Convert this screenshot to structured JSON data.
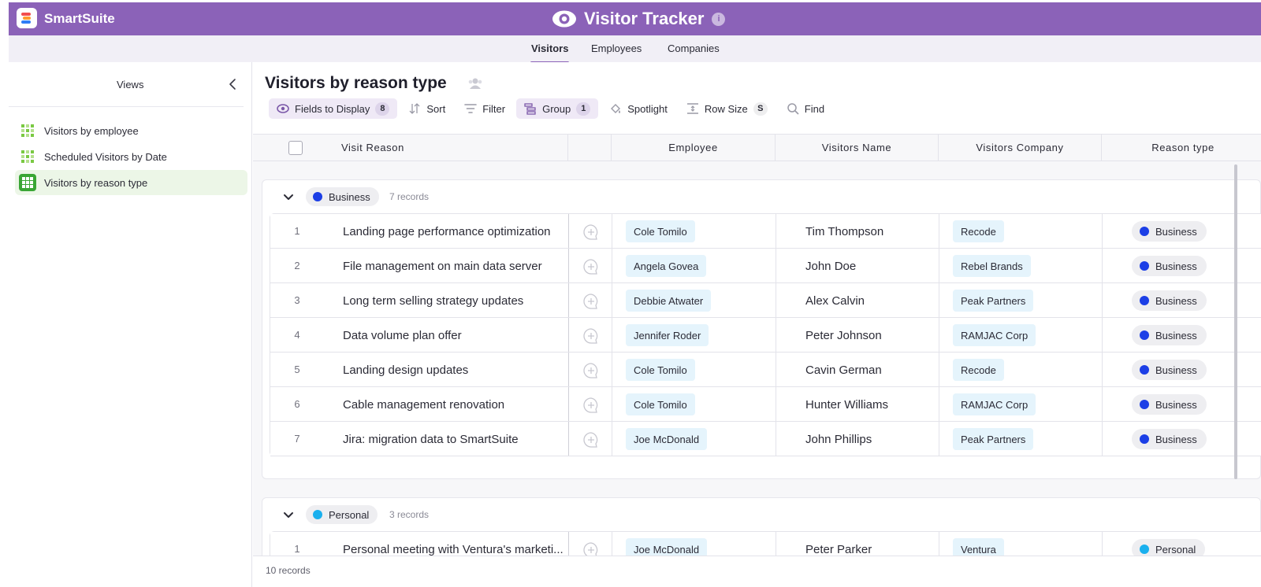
{
  "brand": {
    "name": "SmartSuite"
  },
  "app": {
    "title": "Visitor Tracker",
    "info_icon": "info-icon",
    "accent": "#8b62b8"
  },
  "tabs": [
    {
      "label": "Visitors",
      "active": true
    },
    {
      "label": "Employees",
      "active": false
    },
    {
      "label": "Companies",
      "active": false
    }
  ],
  "sidebar": {
    "title": "Views",
    "items": [
      {
        "label": "Visitors by employee",
        "icon": "grid-view-icon",
        "active": false
      },
      {
        "label": "Scheduled Visitors by Date",
        "icon": "grid-view-icon",
        "active": false
      },
      {
        "label": "Visitors by reason type",
        "icon": "grid-view-icon",
        "active": true
      }
    ]
  },
  "view": {
    "title": "Visitors by reason type",
    "toolbar": {
      "fields": {
        "label": "Fields to Display",
        "count": "8"
      },
      "sort": {
        "label": "Sort"
      },
      "filter": {
        "label": "Filter"
      },
      "group": {
        "label": "Group",
        "count": "1"
      },
      "spotlight": {
        "label": "Spotlight"
      },
      "rowsize": {
        "label": "Row Size",
        "value": "S"
      },
      "find": {
        "label": "Find"
      }
    },
    "columns": {
      "visit_reason": "Visit Reason",
      "employee": "Employee",
      "visitors_name": "Visitors Name",
      "visitors_company": "Visitors Company",
      "reason_type": "Reason type"
    },
    "groups": [
      {
        "label": "Business",
        "color": "#1c3fe6",
        "count_text": "7 records",
        "rows": [
          {
            "num": "1",
            "reason": "Landing page performance optimization",
            "employee": "Cole Tomilo",
            "visitor": "Tim Thompson",
            "company": "Recode",
            "type": "Business"
          },
          {
            "num": "2",
            "reason": "File management on main data server",
            "employee": "Angela Govea",
            "visitor": "John Doe",
            "company": "Rebel Brands",
            "type": "Business"
          },
          {
            "num": "3",
            "reason": "Long term selling strategy updates",
            "employee": "Debbie Atwater",
            "visitor": "Alex Calvin",
            "company": "Peak Partners",
            "type": "Business"
          },
          {
            "num": "4",
            "reason": "Data volume plan offer",
            "employee": "Jennifer Roder",
            "visitor": "Peter Johnson",
            "company": "RAMJAC Corp",
            "type": "Business"
          },
          {
            "num": "5",
            "reason": "Landing design updates",
            "employee": "Cole Tomilo",
            "visitor": "Cavin German",
            "company": "Recode",
            "type": "Business"
          },
          {
            "num": "6",
            "reason": "Cable management renovation",
            "employee": "Cole Tomilo",
            "visitor": "Hunter Williams",
            "company": "RAMJAC Corp",
            "type": "Business"
          },
          {
            "num": "7",
            "reason": "Jira: migration data to SmartSuite",
            "employee": "Joe McDonald",
            "visitor": "John Phillips",
            "company": "Peak Partners",
            "type": "Business"
          }
        ]
      },
      {
        "label": "Personal",
        "color": "#1ab0ee",
        "count_text": "3 records",
        "rows": [
          {
            "num": "1",
            "reason": "Personal meeting with Ventura's marketi...",
            "employee": "Joe McDonald",
            "visitor": "Peter Parker",
            "company": "Ventura",
            "type": "Personal"
          }
        ]
      }
    ],
    "footer": "10 records"
  }
}
